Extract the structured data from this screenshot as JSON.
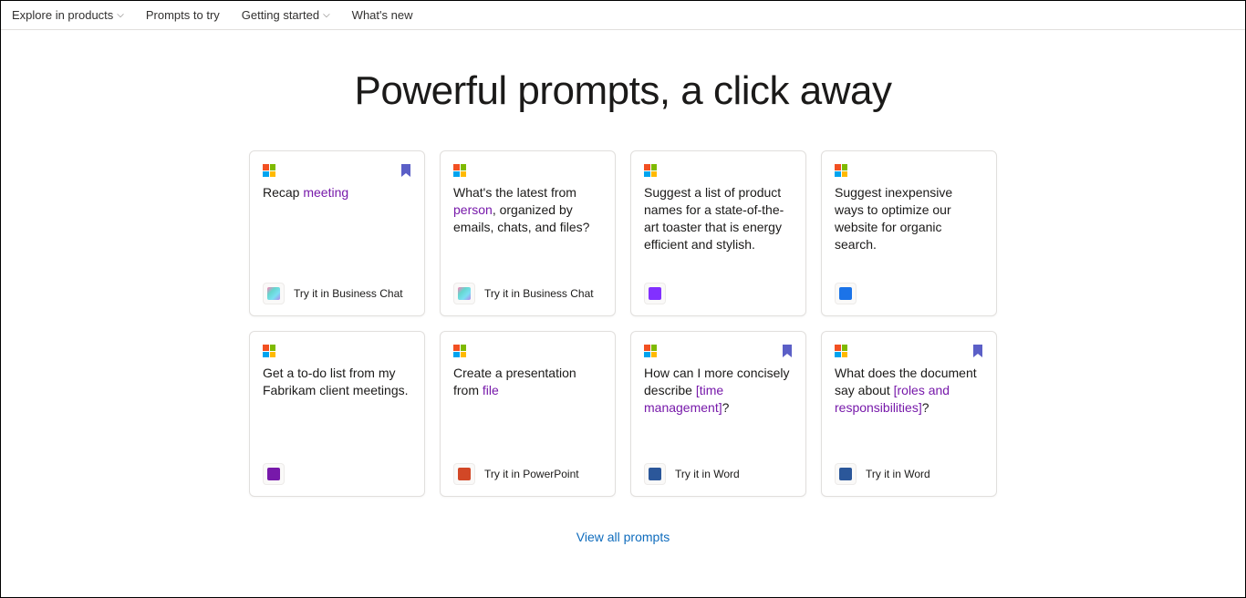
{
  "nav": {
    "explore": "Explore in products",
    "prompts": "Prompts to try",
    "getting_started": "Getting started",
    "whats_new": "What's new"
  },
  "hero": {
    "title": "Powerful prompts, a click away"
  },
  "cards": [
    {
      "prefix": "Recap ",
      "highlight": "meeting",
      "suffix": "",
      "try_label": "Try it in Business Chat",
      "app": "copilot",
      "bookmarked": true
    },
    {
      "prefix": "What's the latest from ",
      "highlight": "person",
      "suffix": ", organized by emails, chats, and files?",
      "try_label": "Try it in Business Chat",
      "app": "copilot",
      "bookmarked": false
    },
    {
      "prefix": "Suggest a list of product names for a state-of-the-art toaster that is energy efficient and stylish.",
      "highlight": "",
      "suffix": "",
      "try_label": "",
      "app": "loop",
      "bookmarked": false
    },
    {
      "prefix": "Suggest inexpensive ways to optimize our website for organic search.",
      "highlight": "",
      "suffix": "",
      "try_label": "",
      "app": "whiteboard",
      "bookmarked": false
    },
    {
      "prefix": "Get a to-do list from my Fabrikam client meetings.",
      "highlight": "",
      "suffix": "",
      "try_label": "",
      "app": "onenote",
      "bookmarked": false
    },
    {
      "prefix": "Create a presentation from ",
      "highlight": "file",
      "suffix": "",
      "try_label": "Try it in PowerPoint",
      "app": "powerpoint",
      "bookmarked": false
    },
    {
      "prefix": "How can I more concisely describe ",
      "highlight": "[time management]",
      "suffix": "?",
      "try_label": "Try it in Word",
      "app": "word",
      "bookmarked": true
    },
    {
      "prefix": "What does the document say about ",
      "highlight": "[roles and responsibilities]",
      "suffix": "?",
      "try_label": "Try it in Word",
      "app": "word",
      "bookmarked": true
    }
  ],
  "view_all": "View all prompts",
  "app_colors": {
    "copilot": "linear-gradient(135deg,#ff7eb3,#65d6ce,#7bdff2,#b388eb)",
    "loop": "#8230ff",
    "whiteboard": "#1b73e8",
    "onenote": "#7719aa",
    "powerpoint": "#d24726",
    "word": "#2b579a"
  }
}
